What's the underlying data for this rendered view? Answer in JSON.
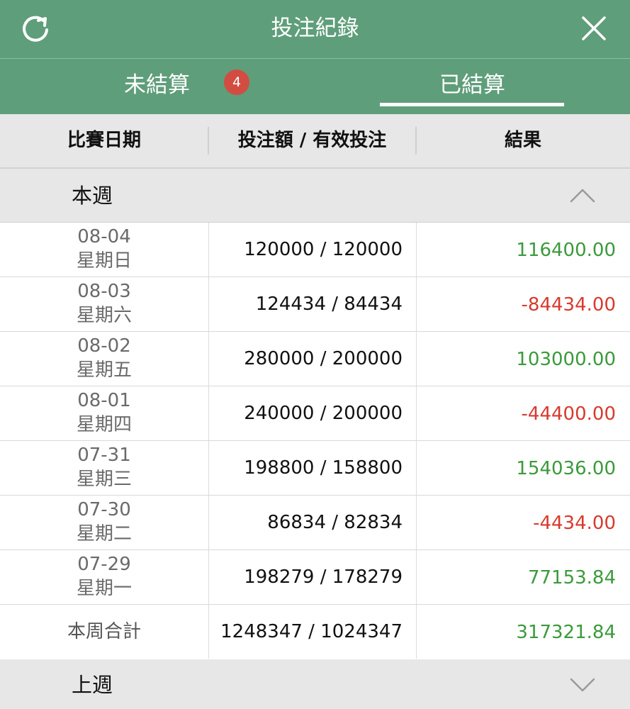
{
  "header": {
    "title": "投注紀錄",
    "refresh_icon": "refresh-icon",
    "close_icon": "close-icon"
  },
  "tabs": {
    "unsettled": {
      "label": "未結算",
      "badge": "4"
    },
    "settled": {
      "label": "已結算",
      "active": true
    }
  },
  "columns": {
    "date": "比賽日期",
    "stake": "投注額 / 有效投注",
    "result": "結果"
  },
  "groups": {
    "this_week": {
      "label": "本週",
      "expanded": true,
      "chevron_icon": "chevron-up-icon"
    },
    "last_week": {
      "label": "上週",
      "expanded": false,
      "chevron_icon": "chevron-down-icon"
    }
  },
  "rows": [
    {
      "date": "08-04",
      "weekday": "星期日",
      "stake": "120000 / 120000",
      "result": "116400.00",
      "sign": "pos"
    },
    {
      "date": "08-03",
      "weekday": "星期六",
      "stake": "124434 / 84434",
      "result": "-84434.00",
      "sign": "neg"
    },
    {
      "date": "08-02",
      "weekday": "星期五",
      "stake": "280000 / 200000",
      "result": "103000.00",
      "sign": "pos"
    },
    {
      "date": "08-01",
      "weekday": "星期四",
      "stake": "240000 / 200000",
      "result": "-44400.00",
      "sign": "neg"
    },
    {
      "date": "07-31",
      "weekday": "星期三",
      "stake": "198800 / 158800",
      "result": "154036.00",
      "sign": "pos"
    },
    {
      "date": "07-30",
      "weekday": "星期二",
      "stake": "86834 / 82834",
      "result": "-4434.00",
      "sign": "neg"
    },
    {
      "date": "07-29",
      "weekday": "星期一",
      "stake": "198279 / 178279",
      "result": "77153.84",
      "sign": "pos"
    }
  ],
  "total": {
    "label": "本周合計",
    "stake": "1248347 / 1024347",
    "result": "317321.84",
    "sign": "pos"
  },
  "colors": {
    "brand_green": "#5f9e7a",
    "positive": "#3b9a3b",
    "negative": "#d83a2e",
    "badge": "#d24c42"
  }
}
